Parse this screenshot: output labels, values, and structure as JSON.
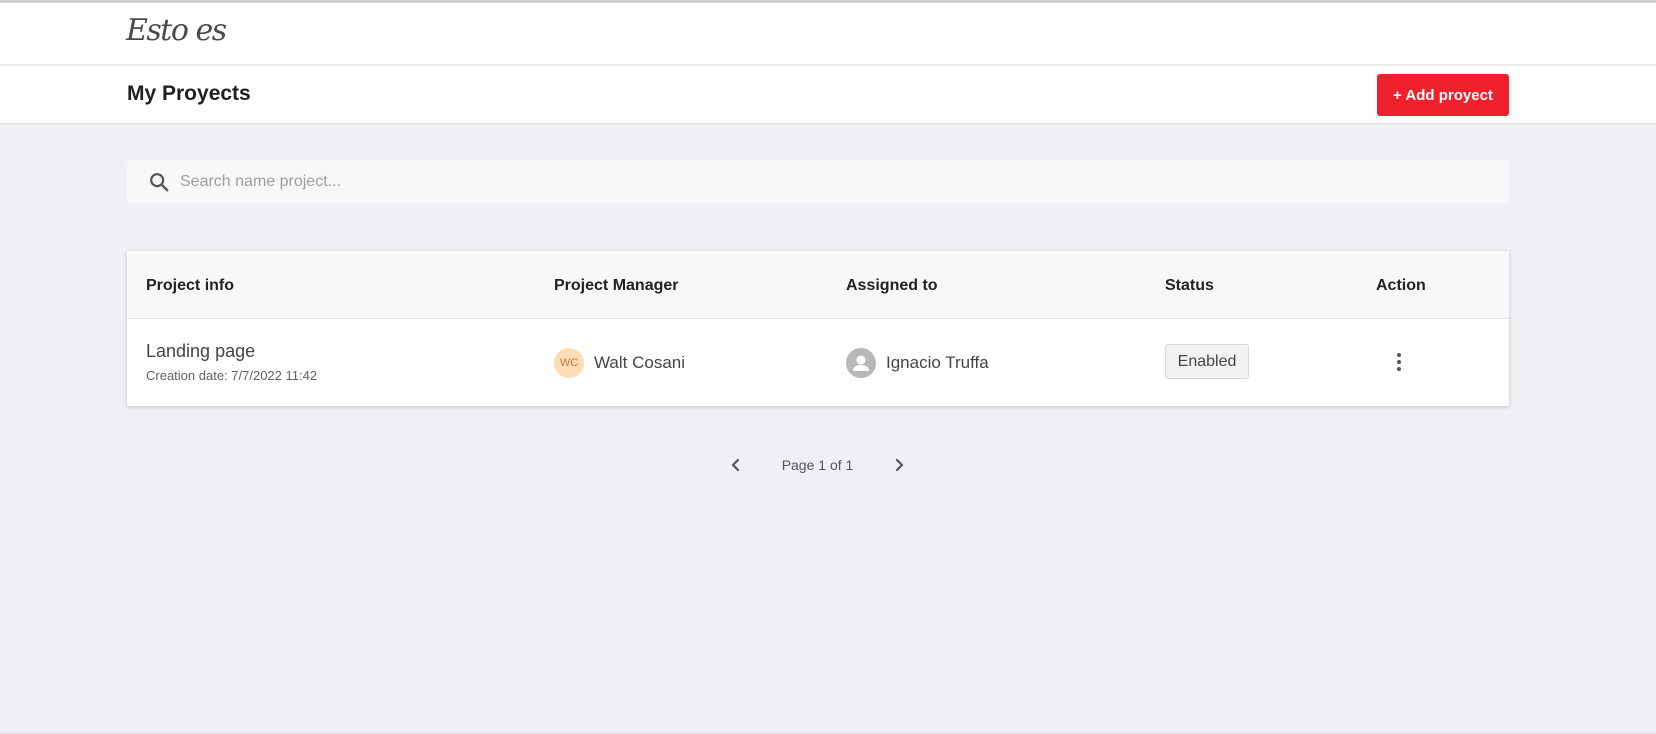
{
  "app": {
    "logo_text": "Esto es"
  },
  "header": {
    "title": "My Proyects",
    "add_button_label": "+ Add proyect"
  },
  "search": {
    "placeholder": "Search name project...",
    "value": ""
  },
  "table": {
    "columns": [
      "Project info",
      "Project Manager",
      "Assigned to",
      "Status",
      "Action"
    ],
    "rows": [
      {
        "project_name": "Landing page",
        "creation_date": "Creation date: 7/7/2022 11:42",
        "manager_initials": "WC",
        "manager_name": "Walt Cosani",
        "assignee_name": "Ignacio Truffa",
        "status": "Enabled"
      }
    ]
  },
  "pagination": {
    "label": "Page 1 of 1"
  },
  "colors": {
    "accent": "#f0212f",
    "background": "#eff0f3",
    "avatar_initials_bg": "#fdddb3"
  },
  "icons": {
    "search": "search-icon",
    "person": "person-icon",
    "more": "more-vertical-icon",
    "prev": "chevron-left-icon",
    "next": "chevron-right-icon"
  }
}
